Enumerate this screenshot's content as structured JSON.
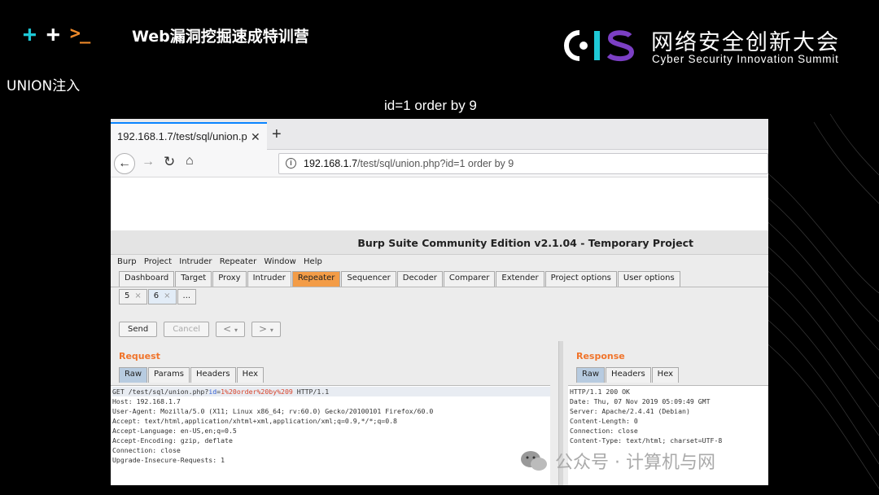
{
  "header": {
    "course_title": "Web漏洞挖掘速成特训营",
    "logo_cn": "网络安全创新大会",
    "logo_en": "Cyber Security Innovation Summit",
    "logo_cis": "CIS"
  },
  "section_label": "UNION注入",
  "caption": "id=1 order by 9",
  "browser": {
    "tab_title": "192.168.1.7/test/sql/union.p",
    "url_host": "192.168.1.7",
    "url_rest": "/test/sql/union.php?id=1 order by 9"
  },
  "burp": {
    "title": "Burp Suite Community Edition v2.1.04 - Temporary Project",
    "menu": [
      "Burp",
      "Project",
      "Intruder",
      "Repeater",
      "Window",
      "Help"
    ],
    "tabs": [
      "Dashboard",
      "Target",
      "Proxy",
      "Intruder",
      "Repeater",
      "Sequencer",
      "Decoder",
      "Comparer",
      "Extender",
      "Project options",
      "User options"
    ],
    "active_tab": "Repeater",
    "sub_tabs": [
      "5",
      "6",
      "..."
    ],
    "buttons": {
      "send": "Send",
      "cancel": "Cancel",
      "prev": "<",
      "next": ">"
    },
    "request": {
      "title": "Request",
      "tabs": [
        "Raw",
        "Params",
        "Headers",
        "Hex"
      ],
      "first_line_a": "GET /test/sql/union.php?",
      "first_line_b": "id",
      "first_line_c": "=",
      "first_line_d": "1%20order%20by%209",
      "first_line_e": " HTTP/1.1",
      "lines": [
        "Host: 192.168.1.7",
        "User-Agent: Mozilla/5.0 (X11; Linux x86_64; rv:60.0) Gecko/20100101 Firefox/60.0",
        "Accept: text/html,application/xhtml+xml,application/xml;q=0.9,*/*;q=0.8",
        "Accept-Language: en-US,en;q=0.5",
        "Accept-Encoding: gzip, deflate",
        "Connection: close",
        "Upgrade-Insecure-Requests: 1"
      ]
    },
    "response": {
      "title": "Response",
      "tabs": [
        "Raw",
        "Headers",
        "Hex"
      ],
      "lines": [
        "HTTP/1.1 200 OK",
        "Date: Thu, 07 Nov 2019 05:09:49 GMT",
        "Server: Apache/2.4.41 (Debian)",
        "Content-Length: 0",
        "Connection: close",
        "Content-Type: text/html; charset=UTF-8"
      ]
    }
  },
  "watermark": "公众号 · 计算机与网",
  "colors": {
    "accent_cyan": "#1ec8d6",
    "accent_orange": "#f08a2a",
    "burp_orange": "#f0742b"
  }
}
